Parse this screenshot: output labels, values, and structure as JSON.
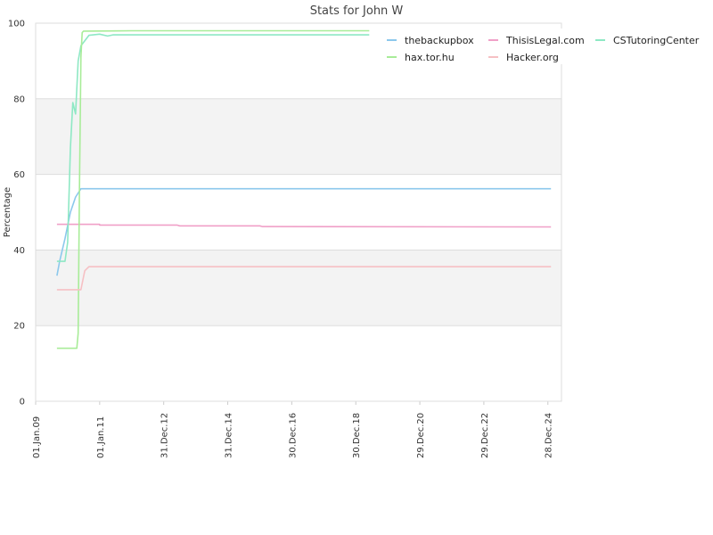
{
  "chart_data": {
    "type": "line",
    "title": "Stats for John W",
    "xlabel": "",
    "ylabel": "Percentage",
    "ylim": [
      0,
      100
    ],
    "y_ticks": [
      0,
      20,
      40,
      60,
      80,
      100
    ],
    "x_ticks": [
      "01.Jan.09",
      "01.Jan.11",
      "31.Dec.12",
      "31.Dec.14",
      "30.Dec.16",
      "30.Dec.18",
      "29.Dec.20",
      "29.Dec.22",
      "28.Dec.24"
    ],
    "xlim": [
      "2009-01-01",
      "2025-06-01"
    ],
    "grid": true,
    "legend_position": "top-right",
    "series": [
      {
        "name": "thebackupbox",
        "color": "#8cc8ec",
        "points": [
          [
            "2009-09-01",
            33.2
          ],
          [
            "2009-10-01",
            37
          ],
          [
            "2009-12-01",
            43
          ],
          [
            "2010-02-01",
            50
          ],
          [
            "2010-04-01",
            54
          ],
          [
            "2010-06-01",
            56.2
          ],
          [
            "2011-01-01",
            56.2
          ],
          [
            "2015-01-01",
            56.2
          ],
          [
            "2020-01-01",
            56.2
          ],
          [
            "2025-02-01",
            56.2
          ]
        ]
      },
      {
        "name": "ThisisLegal.com",
        "color": "#f0a0c8",
        "points": [
          [
            "2009-09-01",
            46.8
          ],
          [
            "2010-12-31",
            46.8
          ],
          [
            "2011-01-01",
            46.6
          ],
          [
            "2013-06-01",
            46.6
          ],
          [
            "2013-07-01",
            46.4
          ],
          [
            "2016-01-01",
            46.4
          ],
          [
            "2016-02-01",
            46.2
          ],
          [
            "2025-02-01",
            46.1
          ]
        ]
      },
      {
        "name": "CSTutoringCenter",
        "color": "#8ee8c4",
        "points": [
          [
            "2009-09-01",
            37
          ],
          [
            "2009-12-01",
            37
          ],
          [
            "2010-01-01",
            42
          ],
          [
            "2010-02-01",
            67
          ],
          [
            "2010-03-01",
            79
          ],
          [
            "2010-04-01",
            76
          ],
          [
            "2010-05-01",
            90
          ],
          [
            "2010-06-01",
            94
          ],
          [
            "2010-09-01",
            96.8
          ],
          [
            "2011-01-01",
            97.1
          ],
          [
            "2011-04-01",
            96.6
          ],
          [
            "2011-06-01",
            96.9
          ],
          [
            "2015-01-01",
            96.9
          ],
          [
            "2019-06-01",
            96.9
          ]
        ]
      },
      {
        "name": "hax.tor.hu",
        "color": "#a8ec98",
        "points": [
          [
            "2009-09-01",
            14
          ],
          [
            "2010-04-15",
            14
          ],
          [
            "2010-05-01",
            18
          ],
          [
            "2010-05-15",
            55
          ],
          [
            "2010-06-01",
            91
          ],
          [
            "2010-06-15",
            97.5
          ],
          [
            "2010-07-01",
            97.9
          ],
          [
            "2012-01-01",
            98
          ],
          [
            "2019-06-01",
            98
          ]
        ]
      },
      {
        "name": "Hacker.org",
        "color": "#f6c0c4",
        "points": [
          [
            "2009-09-01",
            29.5
          ],
          [
            "2010-06-01",
            29.5
          ],
          [
            "2010-07-15",
            34.5
          ],
          [
            "2010-09-01",
            35.6
          ],
          [
            "2015-01-01",
            35.6
          ],
          [
            "2025-02-01",
            35.6
          ]
        ]
      }
    ]
  }
}
